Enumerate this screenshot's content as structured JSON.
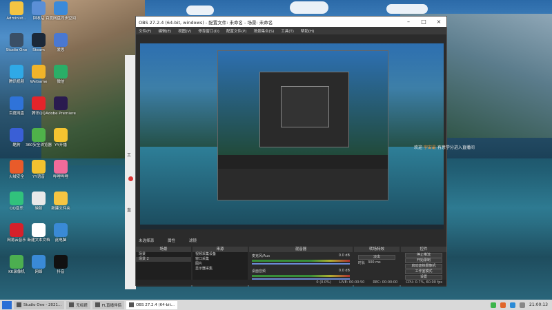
{
  "desktop": {
    "icons": [
      {
        "label": "Administ...",
        "color": "#f5c542",
        "icon": "folder-icon"
      },
      {
        "label": "回收站",
        "color": "#5b8fd6",
        "icon": "recycle-bin-icon"
      },
      {
        "label": "百度网盘同步空间",
        "color": "#3b8ad9",
        "icon": "cloud-icon"
      },
      {
        "label": "Studio One",
        "color": "#3a4f66",
        "icon": "studio-one-icon"
      },
      {
        "label": "Steam",
        "color": "#1b2838",
        "icon": "steam-icon"
      },
      {
        "label": "爱思",
        "color": "#4a78d1",
        "icon": "app-icon"
      },
      {
        "label": "腾讯视频",
        "color": "#2fa9e6",
        "icon": "video-icon"
      },
      {
        "label": "WeGame",
        "color": "#f0b429",
        "icon": "wegame-icon"
      },
      {
        "label": "微信",
        "color": "#2aae67",
        "icon": "wechat-icon"
      },
      {
        "label": "百度网盘",
        "color": "#2f73d9",
        "icon": "baidu-netdisk-icon"
      },
      {
        "label": "腾讯QQ",
        "color": "#e3242b",
        "icon": "qq-icon"
      },
      {
        "label": "Adobe Premiere",
        "color": "#2a1b4f",
        "icon": "premiere-icon"
      },
      {
        "label": "酷狗",
        "color": "#3a5fd6",
        "icon": "music-icon"
      },
      {
        "label": "360安全浏览器",
        "color": "#4fb24a",
        "icon": "browser-icon"
      },
      {
        "label": "YY开播",
        "color": "#f4c430",
        "icon": "yy-icon"
      },
      {
        "label": "火绒安全",
        "color": "#e85b2a",
        "icon": "shield-icon"
      },
      {
        "label": "YY语音",
        "color": "#f1c22f",
        "icon": "yy-voice-icon"
      },
      {
        "label": "哔哩哔哩",
        "color": "#f16b9a",
        "icon": "bilibili-icon"
      },
      {
        "label": "QQ音乐",
        "color": "#31c27c",
        "icon": "qq-music-icon"
      },
      {
        "label": "映射",
        "color": "#e9e9e9",
        "icon": "shortcut-icon"
      },
      {
        "label": "新建文件夹",
        "color": "#f5c542",
        "icon": "folder-icon"
      },
      {
        "label": "网易云音乐",
        "color": "#d6202a",
        "icon": "netease-music-icon"
      },
      {
        "label": "新建文本文档",
        "color": "#ffffff",
        "icon": "text-file-icon"
      },
      {
        "label": "此电脑",
        "color": "#3a8ad6",
        "icon": "computer-icon"
      },
      {
        "label": "KK录像机",
        "color": "#4caf50",
        "icon": "recorder-icon"
      },
      {
        "label": "网络",
        "color": "#3a8ad6",
        "icon": "network-icon"
      },
      {
        "label": "抖音",
        "color": "#111111",
        "icon": "tiktok-icon"
      }
    ]
  },
  "obs": {
    "title": "OBS 27.2.4 (64-bit, windows) - 配置文件: 未命名 - 场景: 未命名",
    "menu": [
      "文件(F)",
      "编辑(E)",
      "视图(V)",
      "停靠窗口(D)",
      "配置文件(P)",
      "场景集合(S)",
      "工具(T)",
      "帮助(H)"
    ],
    "danmaku_prefix": "欢迎 ",
    "danmaku_user": "宇宙最",
    "danmaku_suffix": " 有意学分进入直播间",
    "top_labels": {
      "no_source": "未选择源",
      "properties": "属性",
      "filters": "滤镜"
    },
    "scenes_header": "场景",
    "scenes": [
      "场景",
      "场景 2"
    ],
    "sources_header": "来源",
    "sources": [
      "视频采集设备",
      "窗口采集",
      "图片",
      "显示器采集"
    ],
    "mixer_header": "混音器",
    "mixer": [
      {
        "name": "麦克风/Aux",
        "db": "0.0 dB"
      },
      {
        "name": "桌面音频",
        "db": "0.0 dB"
      }
    ],
    "transition_header": "转场特效",
    "transition_type": "淡出",
    "duration_label": "时长",
    "duration_value": "300 ms",
    "controls_header": "控件",
    "controls": [
      "停止推流",
      "开始录制",
      "启动虚拟摄像机",
      "工作室模式",
      "设置",
      "退出"
    ],
    "status": {
      "dropped": "0 (0.0%)",
      "live": "LIVE: 00:00:50",
      "rec": "REC: 00:00:00",
      "cpu": "CPU: 0.7%, 60.00 fps"
    }
  },
  "side_window": {
    "labels": [
      "工",
      "直"
    ]
  },
  "taskbar": {
    "items": [
      {
        "label": "Studio One - 2021...",
        "active": false
      },
      {
        "label": "无标题",
        "active": false
      },
      {
        "label": "FL直播伴侣",
        "active": false
      },
      {
        "label": "OBS 27.2.4 (64-bit...",
        "active": true
      }
    ],
    "clock": "21:00:13"
  }
}
